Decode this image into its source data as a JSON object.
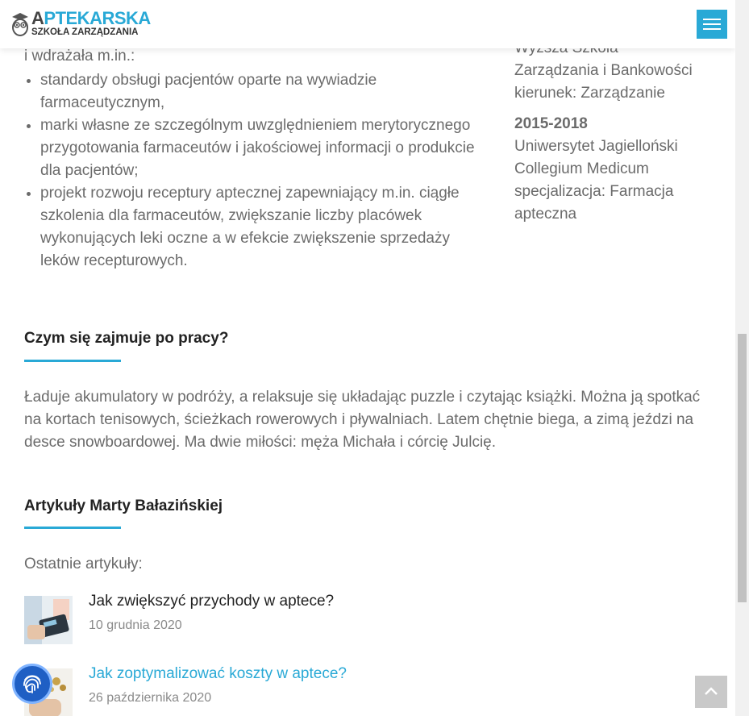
{
  "header": {
    "logo_title": "APTEKARSKA",
    "logo_title_first": "A",
    "logo_title_rest": "PTEKARSKA",
    "logo_subtitle": "SZKOŁA ZARZĄDZANIA",
    "menu_icon": "hamburger-menu-icon"
  },
  "experience": {
    "intro": "i wdrażała m.in.:",
    "items": [
      "standardy obsługi pacjentów oparte na wywiadzie farmaceutycznym,",
      "marki własne ze szczególnym uwzględnieniem merytorycznego przygotowania farmaceutów i jakościowej informacji o produkcie dla pacjentów;",
      "projekt rozwoju receptury aptecznej zapewniający m.in. ciągłe szkolenia dla farmaceutów, zwiększanie liczby placówek wykonujących leki oczne a w efekcie zwiększenie sprzedaży leków recepturowych."
    ]
  },
  "education": {
    "entry1": {
      "school_line1": "Wyższa Szkoła",
      "school_line2": "Zarządzania i Bankowości",
      "field": "kierunek: Zarządzanie"
    },
    "entry2": {
      "years": "2015-2018",
      "school_line1": "Uniwersytet Jagielloński",
      "school_line2": "Collegium Medicum",
      "field_line1": "specjalizacja: Farmacja",
      "field_line2": "apteczna"
    }
  },
  "hobby": {
    "title": "Czym się zajmuje po pracy?",
    "text": "Ładuje akumulatory w podróży, a relaksuje się układając puzzle i czytając książki. Można ją spotkać na kortach tenisowych, ścieżkach rowerowych i pływalniach. Latem chętnie biega, a zimą jeździ na desce snowboardowej. Ma dwie miłości: męża Michała i córcię Julcię."
  },
  "articles": {
    "title": "Artykuły Marty Bałazińskiej",
    "label": "Ostatnie artykuły:",
    "items": [
      {
        "title": "Jak zwiększyć przychody w aptece?",
        "date": "10 grudnia 2020"
      },
      {
        "title": "Jak zoptymalizować koszty w aptece?",
        "date": "26 października 2020"
      }
    ]
  },
  "widgets": {
    "fingerprint_icon": "fingerprint-icon",
    "back_to_top_icon": "chevron-up-icon"
  },
  "colors": {
    "accent": "#29a9d6",
    "text": "#6b6b6b",
    "heading": "#222222",
    "widget_blue": "#1f5fc4"
  }
}
